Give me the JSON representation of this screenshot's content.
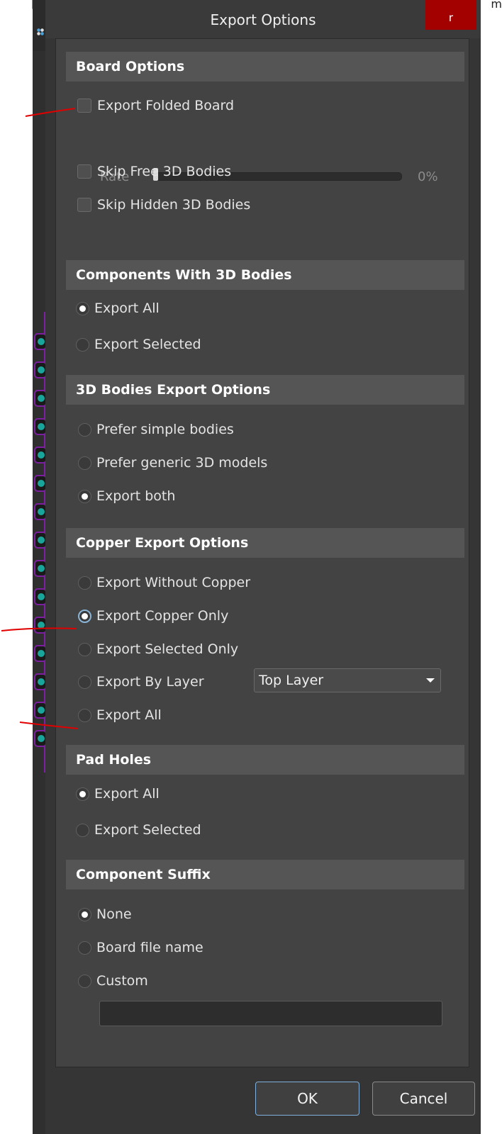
{
  "background": {
    "left_bracket": "[S",
    "right_text": "m"
  },
  "dialog": {
    "title": "Export Options",
    "close_label": "r",
    "colors": {
      "dialog_bg": "#353535",
      "content_bg": "#434343",
      "section_bg": "#555555",
      "close_bg": "#a30000",
      "annotation": "#e00000"
    }
  },
  "board_options": {
    "header": "Board Options",
    "export_folded_board": {
      "label": "Export Folded Board",
      "checked": false
    },
    "rate": {
      "label": "Rate",
      "value_text": "0%",
      "value": 0
    },
    "skip_free": {
      "label": "Skip Free 3D Bodies",
      "checked": false
    },
    "skip_hidden": {
      "label": "Skip Hidden 3D Bodies",
      "checked": false
    }
  },
  "components_3d": {
    "header": "Components With 3D Bodies",
    "options": [
      {
        "label": "Export All",
        "checked": true
      },
      {
        "label": "Export Selected",
        "checked": false
      }
    ]
  },
  "bodies_export": {
    "header": "3D Bodies Export Options",
    "options": [
      {
        "label": "Prefer simple bodies",
        "checked": false
      },
      {
        "label": "Prefer generic 3D models",
        "checked": false
      },
      {
        "label": "Export both",
        "checked": true
      }
    ]
  },
  "copper_export": {
    "header": "Copper Export Options",
    "options": [
      {
        "label": "Export Without Copper",
        "checked": false
      },
      {
        "label": "Export Copper Only",
        "checked": true
      },
      {
        "label": "Export Selected Only",
        "checked": false
      },
      {
        "label": "Export By Layer",
        "checked": false
      },
      {
        "label": "Export All",
        "checked": false
      }
    ],
    "layer_dropdown": {
      "selected": "Top Layer"
    }
  },
  "pad_holes": {
    "header": "Pad Holes",
    "options": [
      {
        "label": "Export All",
        "checked": true
      },
      {
        "label": "Export Selected",
        "checked": false
      }
    ]
  },
  "component_suffix": {
    "header": "Component Suffix",
    "options": [
      {
        "label": "None",
        "checked": true
      },
      {
        "label": "Board file name",
        "checked": false
      },
      {
        "label": "Custom",
        "checked": false
      }
    ],
    "custom_value": ""
  },
  "buttons": {
    "ok": "OK",
    "cancel": "Cancel"
  }
}
